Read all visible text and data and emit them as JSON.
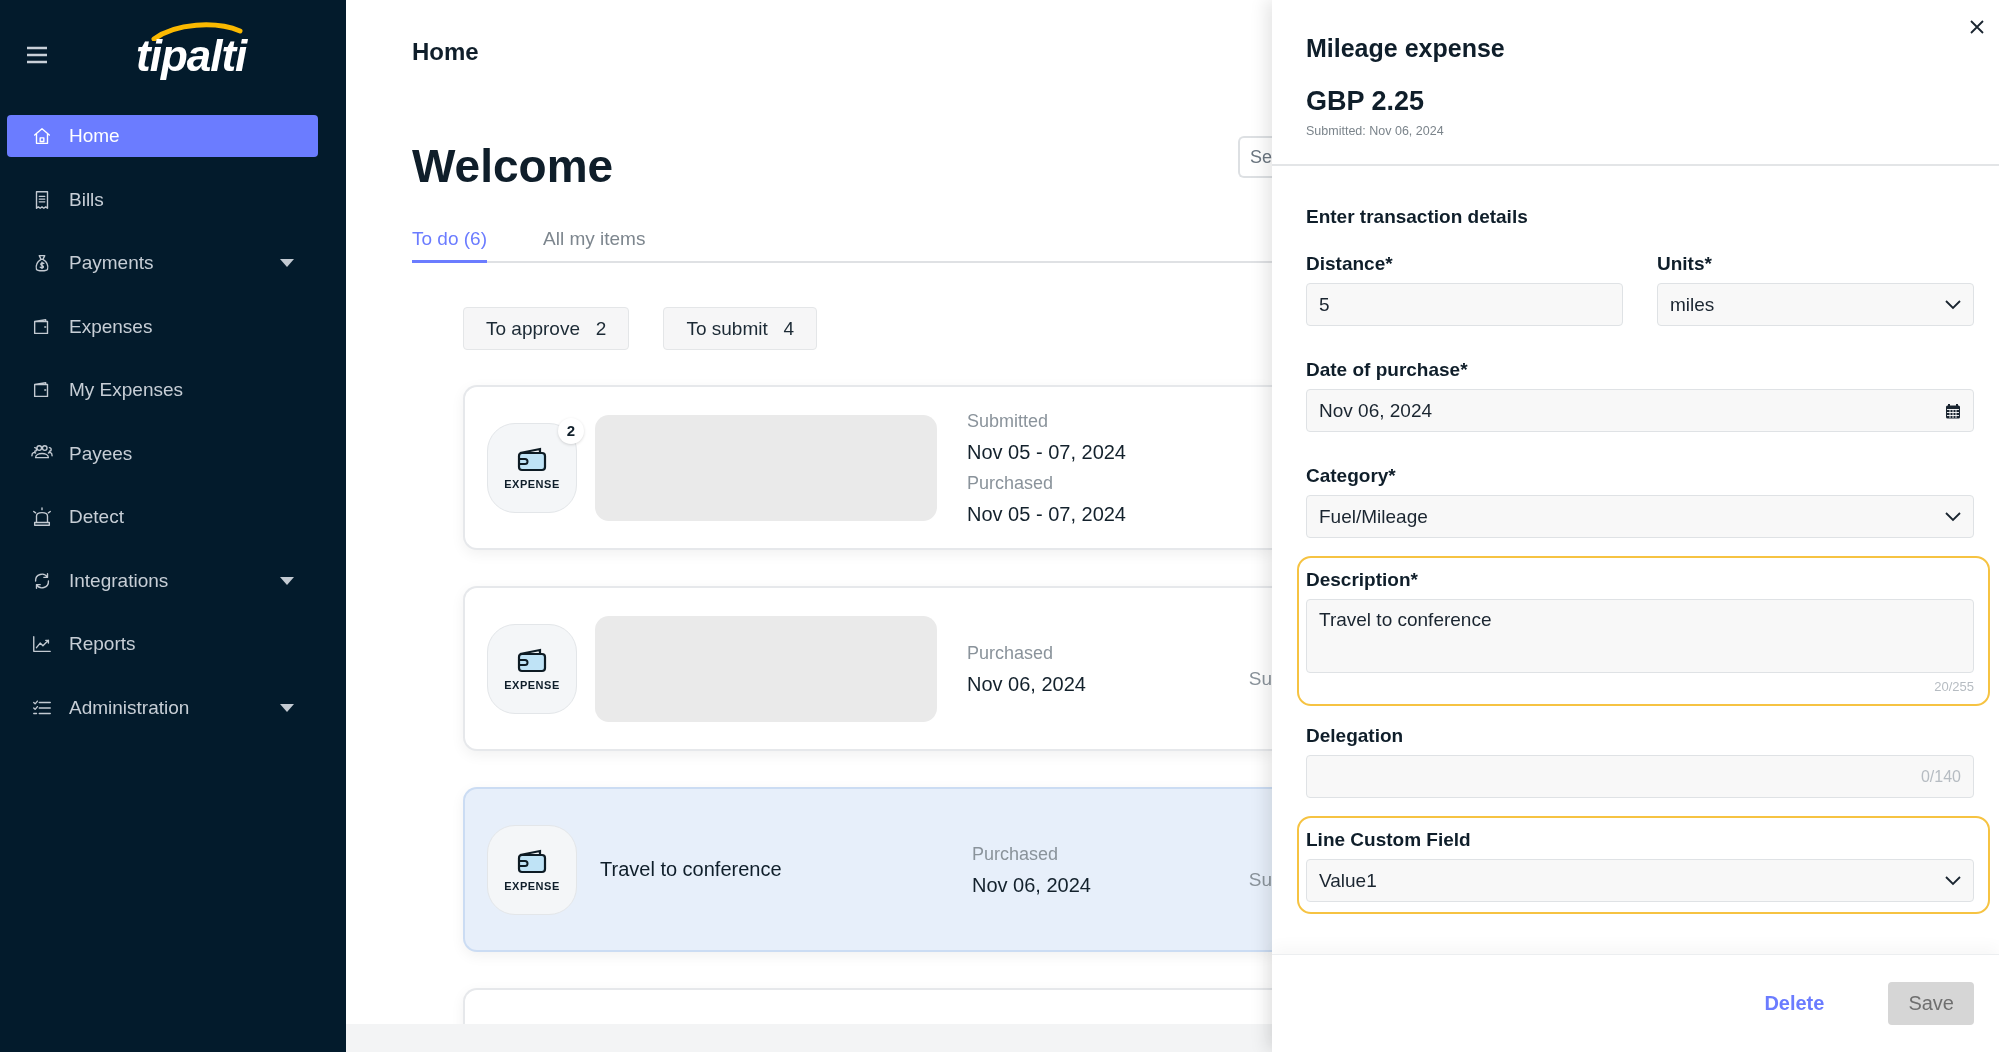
{
  "sidebar": {
    "logo": "tipalti",
    "items": [
      {
        "label": "Home",
        "selected": true,
        "expandable": false
      },
      {
        "label": "Bills",
        "selected": false,
        "expandable": false
      },
      {
        "label": "Payments",
        "selected": false,
        "expandable": true
      },
      {
        "label": "Expenses",
        "selected": false,
        "expandable": false
      },
      {
        "label": "My Expenses",
        "selected": false,
        "expandable": false
      },
      {
        "label": "Payees",
        "selected": false,
        "expandable": false
      },
      {
        "label": "Detect",
        "selected": false,
        "expandable": false
      },
      {
        "label": "Integrations",
        "selected": false,
        "expandable": true
      },
      {
        "label": "Reports",
        "selected": false,
        "expandable": false
      },
      {
        "label": "Administration",
        "selected": false,
        "expandable": true
      }
    ]
  },
  "page_title": "Home",
  "heading": "Welcome",
  "search": {
    "placeholder": "Se"
  },
  "tabs": [
    {
      "label": "To do (6)",
      "selected": true
    },
    {
      "label": "All my items",
      "selected": false
    }
  ],
  "filters": [
    {
      "label": "To approve",
      "count": "2"
    },
    {
      "label": "To submit",
      "count": "4"
    }
  ],
  "cards": [
    {
      "kind": "redacted",
      "selected": false,
      "type_label": "EXPENSE",
      "badge": "2",
      "dates": [
        {
          "label": "Submitted",
          "value": "Nov 05 - 07, 2024"
        },
        {
          "label": "Purchased",
          "value": "Nov 05 - 07, 2024"
        }
      ]
    },
    {
      "kind": "redacted",
      "selected": false,
      "type_label": "EXPENSE",
      "dates": [
        {
          "label": "Purchased",
          "value": "Nov 06, 2024"
        }
      ],
      "column_3": "Su"
    },
    {
      "kind": "text",
      "selected": true,
      "type_label": "EXPENSE",
      "title": "Travel to conference",
      "dates": [
        {
          "label": "Purchased",
          "value": "Nov 06, 2024"
        }
      ],
      "column_3": "Su"
    },
    {
      "kind": "empty",
      "selected": false
    }
  ],
  "panel": {
    "title": "Mileage expense",
    "amount": "GBP 2.25",
    "submitted": "Submitted: Nov 06, 2024",
    "section_title": "Enter transaction details",
    "rows": [
      {
        "fields": [
          {
            "kind": "input",
            "label": "Distance*",
            "value": "5",
            "highlighted": false
          },
          {
            "kind": "select",
            "label": "Units*",
            "value": "miles",
            "highlighted": false
          }
        ]
      },
      {
        "fields": [
          {
            "kind": "date",
            "label": "Date of purchase*",
            "value": "Nov 06, 2024",
            "highlighted": false
          }
        ]
      },
      {
        "fields": [
          {
            "kind": "select",
            "label": "Category*",
            "value": "Fuel/Mileage",
            "highlighted": false
          }
        ]
      },
      {
        "fields": [
          {
            "kind": "textarea",
            "label": "Description*",
            "value": "Travel to conference",
            "counter": "20/255",
            "highlighted": true
          }
        ]
      },
      {
        "fields": [
          {
            "kind": "counted",
            "label": "Delegation",
            "counter": "0/140",
            "highlighted": false
          }
        ]
      },
      {
        "fields": [
          {
            "kind": "select",
            "label": "Line Custom Field",
            "value": "Value1",
            "highlighted": true
          }
        ]
      }
    ],
    "delete_label": "Delete",
    "save": {
      "label": "Save",
      "disabled": true
    }
  }
}
